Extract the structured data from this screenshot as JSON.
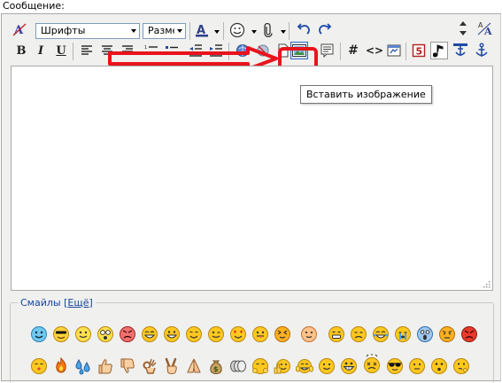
{
  "field": {
    "label": "Сообщение:"
  },
  "toolbar": {
    "font_select": "Шрифты",
    "size_select": "Разме",
    "bold": "B",
    "italic": "I",
    "underline": "U",
    "hash": "#",
    "code": "<>"
  },
  "tooltip": {
    "text": "Вставить изображение"
  },
  "smiles": {
    "legend": "Смайлы",
    "more_open": "[",
    "more": "Ещё",
    "more_close": "]"
  },
  "colors": {
    "highlight": "#e8141c",
    "link": "#16449c",
    "toolbar_bg": "#f0f0ee"
  }
}
